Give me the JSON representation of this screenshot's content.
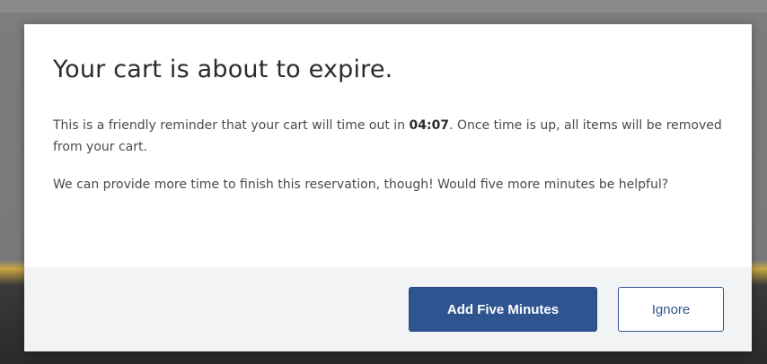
{
  "modal": {
    "title": "Your cart is about to expire.",
    "paragraph1_before": "This is a friendly reminder that your cart will time out in ",
    "timer": "04:07",
    "paragraph1_after": ". Once time is up, all items will be removed from your cart.",
    "paragraph2": "We can provide more time to finish this reservation, though! Would five more minutes be helpful?",
    "primary_button_label": "Add Five Minutes",
    "secondary_button_label": "Ignore"
  },
  "colors": {
    "primary": "#2e5590",
    "footer_bg": "#f1f3f5",
    "title_text": "#2b2b2b",
    "body_text": "#4a4a4a"
  }
}
